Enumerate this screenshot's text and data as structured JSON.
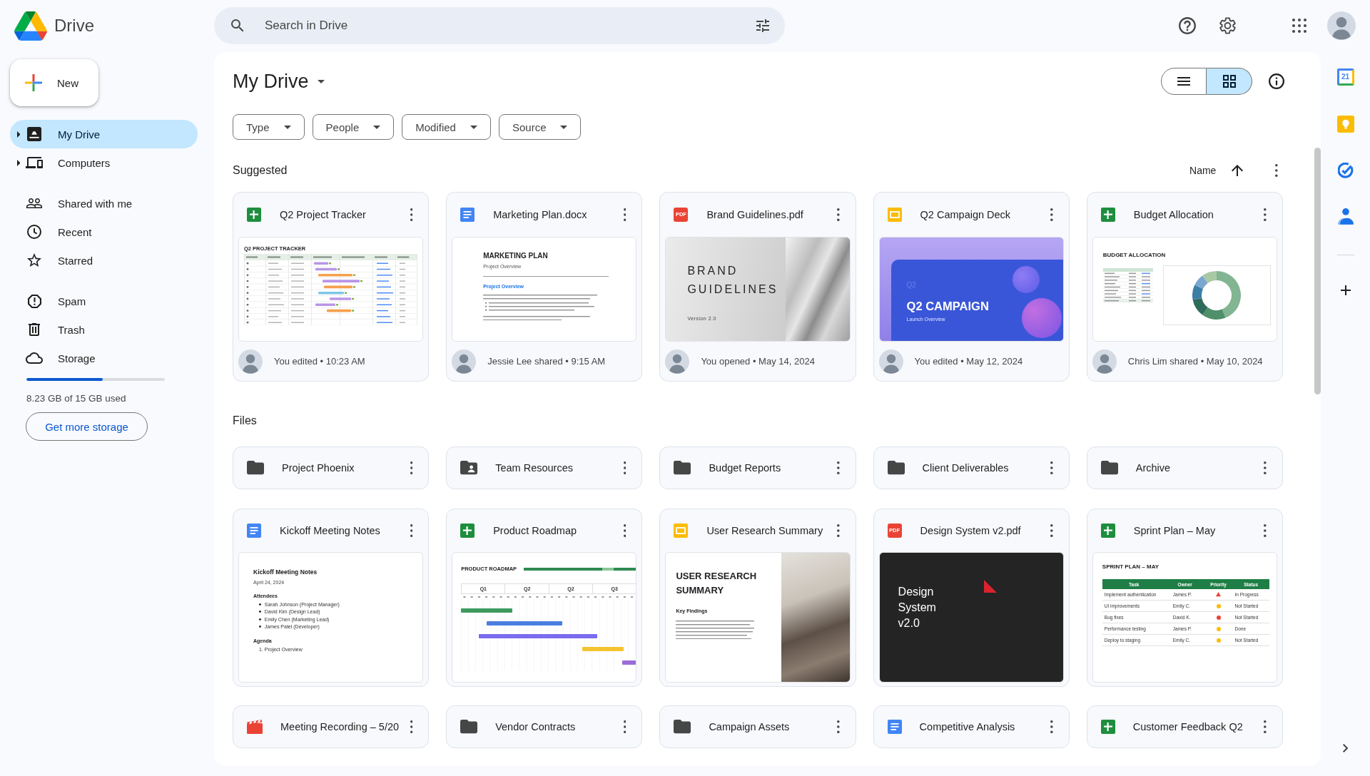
{
  "app": {
    "name": "Drive"
  },
  "search": {
    "placeholder": "Search in Drive"
  },
  "new_button": {
    "label": "New"
  },
  "sidebar": {
    "groups": [
      {
        "items": [
          {
            "label": "My Drive",
            "selected": true,
            "expanded": false
          },
          {
            "label": "Computers",
            "selected": false,
            "expanded": false
          }
        ]
      },
      {
        "items": [
          {
            "label": "Shared with me",
            "selected": false
          },
          {
            "label": "Recent",
            "selected": false
          },
          {
            "label": "Starred",
            "selected": false
          }
        ]
      },
      {
        "items": [
          {
            "label": "Spam",
            "selected": false
          },
          {
            "label": "Trash",
            "selected": false
          },
          {
            "label": "Storage",
            "selected": false
          }
        ]
      }
    ]
  },
  "storage": {
    "level": 0.55,
    "usage": "8.23 GB of 15 GB used",
    "button": "Get more storage"
  },
  "main": {
    "title": "My Drive",
    "view_modes": [
      {
        "selected": false
      },
      {
        "selected": true
      }
    ],
    "filters": [
      "Type",
      "People",
      "Modified",
      "Source"
    ]
  },
  "suggested": {
    "heading": "Suggested",
    "sort": {
      "label": "Name",
      "ascending": true
    },
    "cards": [
      {
        "kind": "sheet",
        "title": "Q2 Project Tracker",
        "activity": "You edited • 10:23 AM",
        "preview": {
          "kind": "tracker",
          "title": "Q2 PROJECT TRACKER"
        }
      },
      {
        "kind": "doc",
        "title": "Marketing Plan.docx",
        "activity": "Jessie Lee shared • 9:15 AM",
        "preview": {
          "kind": "document",
          "title": "MARKETING PLAN",
          "subtitle": "Project Overview",
          "heading": "Project Overview"
        }
      },
      {
        "kind": "pdf",
        "icon_text": "PDF",
        "title": "Brand Guidelines.pdf",
        "activity": "You opened • May 14, 2024",
        "preview": {
          "kind": "brand",
          "title": "BRAND GUIDELINES",
          "version": "Version 2.0"
        }
      },
      {
        "kind": "slides",
        "title": "Q2 Campaign Deck",
        "activity": "You edited • May 12, 2024",
        "preview": {
          "kind": "deck",
          "overline": "Q2",
          "title": "Q2 CAMPAIGN",
          "subtitle": "Launch Overview"
        }
      },
      {
        "kind": "sheet",
        "title": "Budget Allocation",
        "activity": "Chris Lim shared • May 10, 2024",
        "preview": {
          "kind": "budget",
          "title": "BUDGET ALLOCATION"
        }
      }
    ]
  },
  "files": {
    "heading": "Files",
    "folders": [
      {
        "kind": "folder",
        "title": "Project Phoenix"
      },
      {
        "kind": "shared_folder",
        "title": "Team Resources"
      },
      {
        "kind": "folder",
        "title": "Budget Reports"
      },
      {
        "kind": "folder",
        "title": "Client Deliverables"
      },
      {
        "kind": "folder",
        "title": "Archive"
      }
    ],
    "cards": [
      {
        "kind": "doc",
        "title": "Kickoff Meeting Notes",
        "preview": {
          "kind": "notes",
          "title": "Kickoff Meeting Notes",
          "date": "April 24, 2024",
          "sections": [
            {
              "heading": "Attendees",
              "bullets": [
                "Sarah Johnson (Project Manager)",
                "David Kim (Design Lead)",
                "Emily Chen (Marketing Lead)",
                "James Patel (Developer)"
              ]
            },
            {
              "heading": "Agenda",
              "lines": [
                "1. Project Overview"
              ]
            }
          ]
        }
      },
      {
        "kind": "sheet",
        "title": "Product Roadmap",
        "preview": {
          "kind": "roadmap",
          "title": "PRODUCT ROADMAP",
          "quarters": [
            "Q1",
            "Q2",
            "Q2",
            "Q3"
          ]
        }
      },
      {
        "kind": "slides",
        "title": "User Research Summary",
        "preview": {
          "kind": "research",
          "title": "USER RESEARCH SUMMARY",
          "heading": "Key Findings"
        }
      },
      {
        "kind": "pdf",
        "icon_text": "PDF",
        "title": "Design System v2.pdf",
        "preview": {
          "kind": "cover",
          "title": "Design System v2.0"
        }
      },
      {
        "kind": "sheet",
        "title": "Sprint Plan – May",
        "preview": {
          "kind": "sprint",
          "title": "SPRINT PLAN – MAY",
          "columns": [
            "Task",
            "Owner",
            "Priority",
            "Status"
          ],
          "rows": [
            {
              "task": "Implement authentication",
              "owner": "James P.",
              "priority": {
                "kind": "triangle",
                "color": "#ea4335"
              },
              "status": "In Progress"
            },
            {
              "task": "UI improvements",
              "owner": "Emily C.",
              "priority": {
                "kind": "dot",
                "color": "#fbbc04"
              },
              "status": "Not Started"
            },
            {
              "task": "Bug fixes",
              "owner": "David K.",
              "priority": {
                "kind": "dot",
                "color": "#ea4335"
              },
              "status": "Not Started"
            },
            {
              "task": "Performance testing",
              "owner": "James P.",
              "priority": {
                "kind": "dot",
                "color": "#fbbc04"
              },
              "status": "Done"
            },
            {
              "task": "Deploy to staging",
              "owner": "Emily C.",
              "priority": {
                "kind": "dot",
                "color": "#fbbc04"
              },
              "status": "Not Started"
            }
          ]
        }
      }
    ],
    "tiles": [
      {
        "kind": "video",
        "title": "Meeting Recording – 5/20"
      },
      {
        "kind": "folder",
        "title": "Vendor Contracts"
      },
      {
        "kind": "folder",
        "title": "Campaign Assets"
      },
      {
        "kind": "doc",
        "title": "Competitive Analysis"
      },
      {
        "kind": "sheet",
        "title": "Customer Feedback Q2"
      }
    ]
  },
  "side_apps": {
    "calendar_day": "21"
  }
}
